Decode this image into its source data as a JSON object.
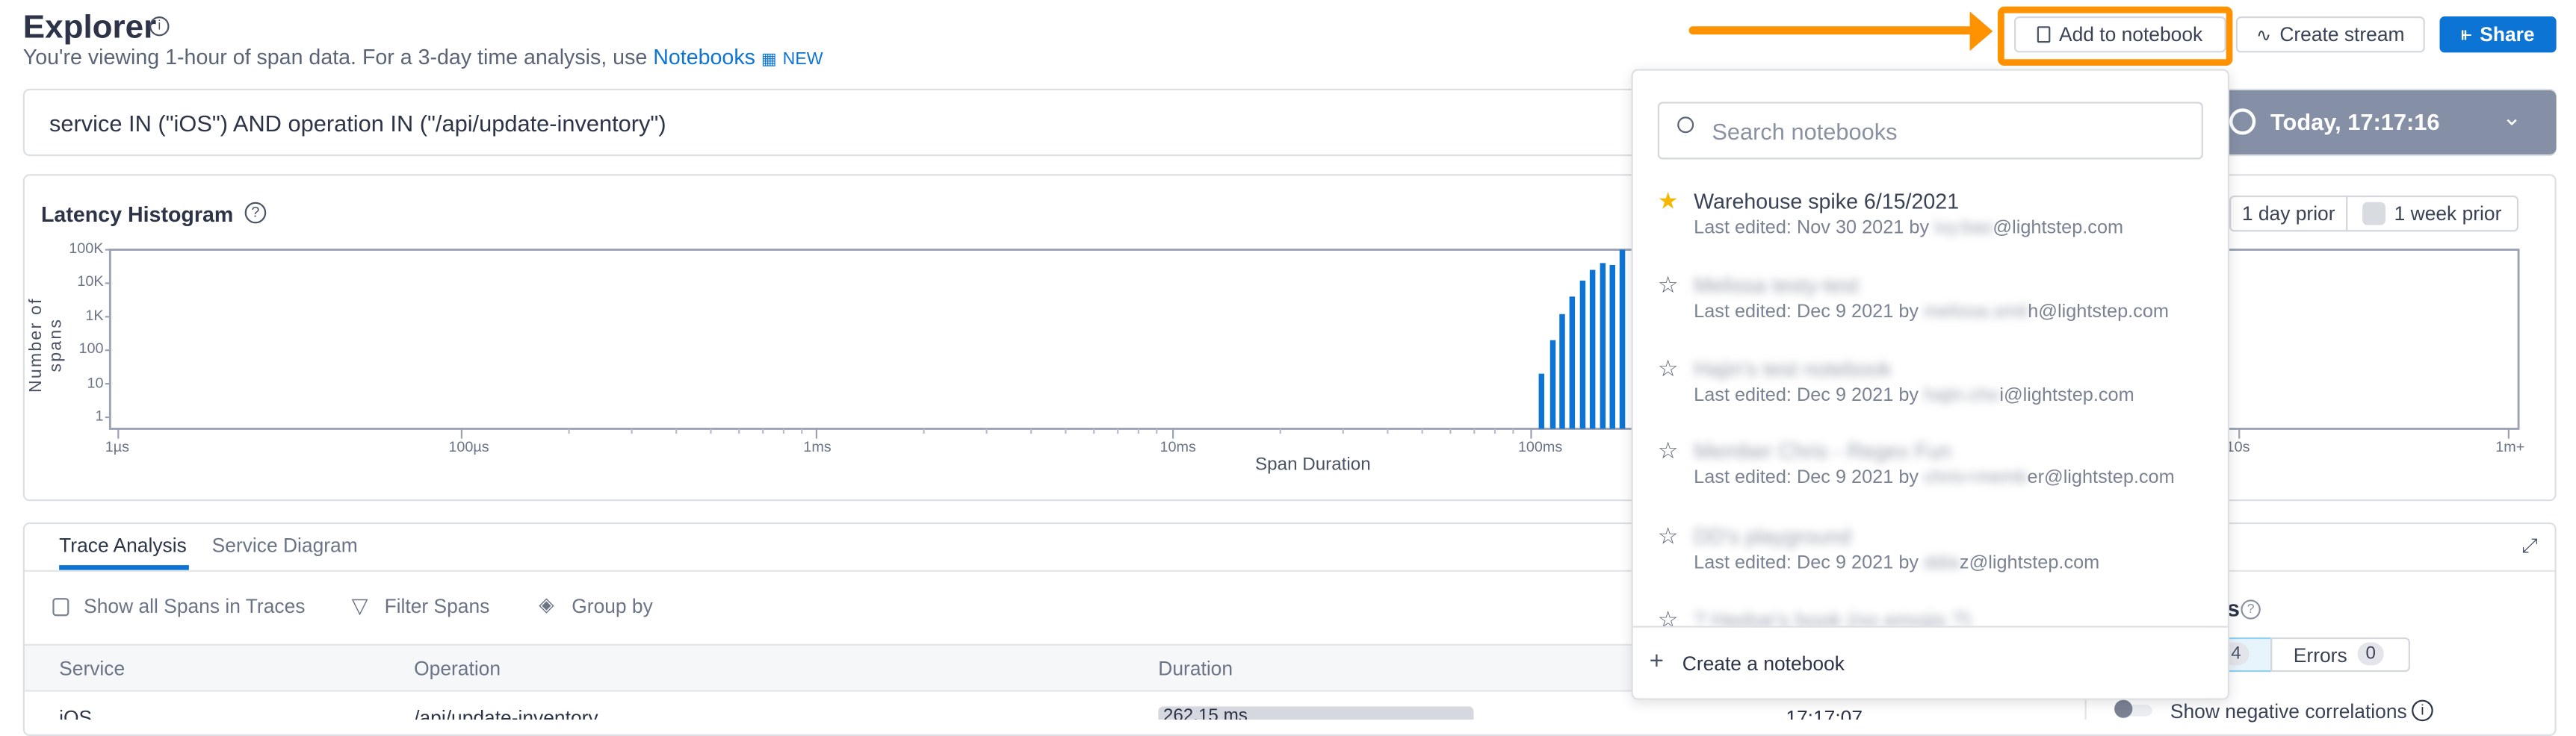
{
  "header": {
    "title": "Explorer",
    "subtitle": "You're viewing 1-hour of span data. For a 3-day time analysis, use",
    "notebooks_link": "Notebooks",
    "new_badge": "NEW"
  },
  "toolbar": {
    "add_to_notebook": "Add to notebook",
    "create_stream": "Create stream",
    "share": "Share"
  },
  "query": {
    "value": "service IN (\"iOS\") AND operation IN (\"/api/update-inventory\")",
    "time": "Today, 17:17:16"
  },
  "histogram": {
    "title": "Latency Histogram",
    "compare": [
      "1 day prior",
      "1 week prior"
    ]
  },
  "chart_data": {
    "type": "bar",
    "title": "Latency Histogram",
    "xlabel": "Span Duration",
    "ylabel": "Number of spans",
    "yscale": "log",
    "xscale": "log",
    "ylim": [
      1,
      100000
    ],
    "y_ticks": [
      "100K",
      "10K",
      "1K",
      "100",
      "10",
      "1"
    ],
    "x_ticks": [
      "1µs",
      "100µs",
      "1ms",
      "10ms",
      "100ms",
      "10s",
      "1m+"
    ],
    "x_ms": [
      105,
      113,
      120,
      128,
      137,
      146,
      156,
      166,
      177
    ],
    "values": [
      20,
      200,
      1200,
      4000,
      12000,
      25000,
      40000,
      35000,
      100000
    ],
    "color": "#0b74d5",
    "grid": false
  },
  "analysis": {
    "tabs": [
      "Trace Analysis",
      "Service Diagram"
    ],
    "active_tab": "Trace Analysis",
    "show_all_spans": "Show all Spans in Traces",
    "filter_spans": "Filter Spans",
    "group_by": "Group by",
    "columns": [
      "Service",
      "Operation",
      "Duration"
    ],
    "rows": [
      {
        "service": "iOS",
        "operation": "/api/update-inventory",
        "duration": "262.15 ms",
        "time": "17:17:07"
      }
    ]
  },
  "correlations": {
    "title_fragment": "ns",
    "segment_count_fragment": "4",
    "errors_label": "Errors",
    "errors_count": "0",
    "negative_toggle": "Show negative correlations"
  },
  "notebook_dropdown": {
    "search_placeholder": "Search notebooks",
    "items": [
      {
        "name": "Warehouse spike 6/15/2021",
        "starred": true,
        "edited": "Last edited: Nov 30 2021 by",
        "email_hidden": "ivy.bao",
        "email_visible": "@lightstep.com"
      },
      {
        "name": "Melissa testy-test",
        "starred": false,
        "edited": "Last edited: Dec 9 2021 by",
        "email_hidden": "melissa.smit",
        "email_visible": "h@lightstep.com"
      },
      {
        "name": "Hajin's test notebook",
        "starred": false,
        "edited": "Last edited: Dec 9 2021 by",
        "email_hidden": "hajin.cho",
        "email_visible": "i@lightstep.com"
      },
      {
        "name": "Member Chris - Regex Fun",
        "starred": false,
        "edited": "Last edited: Dec 9 2021 by",
        "email_hidden": "chris+memb",
        "email_visible": "er@lightstep.com"
      },
      {
        "name": "DD's playground",
        "starred": false,
        "edited": "Last edited: Dec 9 2021 by",
        "email_hidden": "ddia",
        "email_visible": "z@lightstep.com"
      },
      {
        "name": "? Hedoe's book (no emojis ?)",
        "starred": false,
        "edited": "",
        "email_hidden": "",
        "email_visible": ""
      }
    ],
    "create_label": "Create a notebook"
  },
  "colors": {
    "accent": "#0b74d5",
    "highlight": "#ff9200",
    "star": "#f5b800",
    "time_button": "#8590a6"
  }
}
